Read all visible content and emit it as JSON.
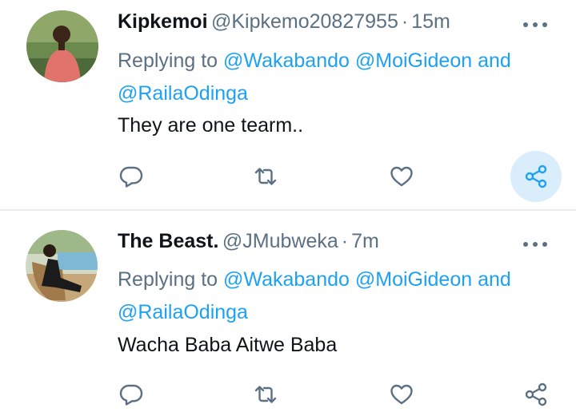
{
  "tweets": [
    {
      "name": "Kipkemoi",
      "handle": "@Kipkemo20827955",
      "separator": "·",
      "time": "15m",
      "replying_prefix": "Replying to",
      "mention_1": "@Wakabando",
      "mention_2": "@MoiGideon",
      "mention_joiner": "and",
      "mention_3": "@RailaOdinga",
      "text": "They are one tearm..",
      "share_highlighted": true
    },
    {
      "name": "The Beast.",
      "handle": "@JMubweka",
      "separator": "·",
      "time": "7m",
      "replying_prefix": "Replying to",
      "mention_1": "@Wakabando",
      "mention_2": "@MoiGideon",
      "mention_joiner": "and",
      "mention_3": "@RailaOdinga",
      "text": "Wacha Baba Aitwe Baba",
      "share_highlighted": false
    }
  ],
  "icons": {
    "reply": "reply-icon",
    "retweet": "retweet-icon",
    "like": "like-icon",
    "share": "share-icon",
    "more": "more-icon"
  },
  "colors": {
    "accent": "#1da1f2",
    "secondary_text": "#5b7083",
    "share_highlight": "#d9edfb"
  }
}
